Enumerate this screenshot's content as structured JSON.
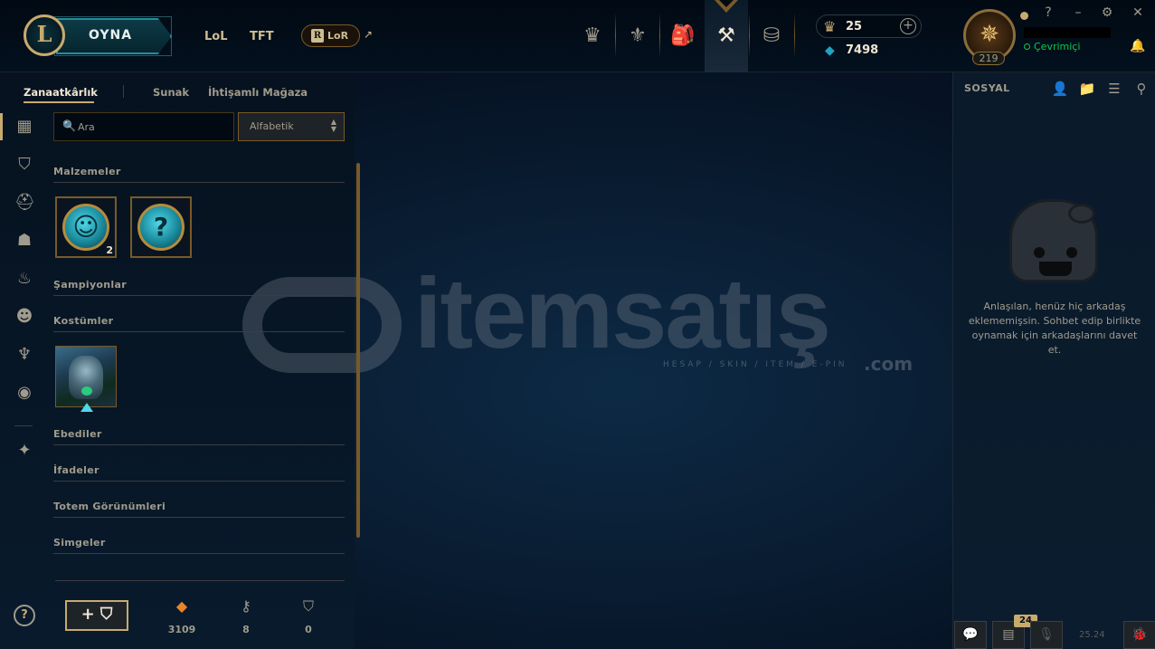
{
  "header": {
    "logo": "L",
    "play_label": "OYNA",
    "links": [
      "LoL",
      "TFT"
    ],
    "lor_label": "LoR",
    "lor_logo": "R",
    "external_icon": "external-link-icon",
    "nav_icons": [
      "worlds-trophy-icon",
      "clash-icon",
      "store-bag-icon",
      "crafting-hammer-icon",
      "coins-stack-icon"
    ],
    "active_nav": "crafting-hammer-icon",
    "riot_points": "25",
    "add_rp": "+",
    "blue_essence": "7498",
    "summoner_level": "219",
    "status": "Çevrimiçi",
    "window_controls": [
      "?",
      "–",
      "⚙",
      "✕"
    ]
  },
  "subtabs": [
    "Zanaatkârlık",
    "Sunak",
    "İhtişamlı Mağaza"
  ],
  "active_subtab": "Zanaatkârlık",
  "rail": {
    "icons": [
      "grid-icon",
      "chest-icon",
      "champion-helmet-icon",
      "skin-mask-icon",
      "ward-flame-icon",
      "emote-face-icon",
      "totem-icon",
      "summoner-icon-icon",
      "eternals-icon"
    ],
    "help": "?"
  },
  "search": {
    "placeholder": "Ara"
  },
  "sort": {
    "selected": "Alfabetik"
  },
  "categories": {
    "materials": "Malzemeler",
    "champions": "Şampiyonlar",
    "skins": "Kostümler",
    "eternals": "Ebediler",
    "emotes": "İfadeler",
    "ward_skins": "Totem Görünümleri",
    "icons": "Simgeler"
  },
  "materials": [
    {
      "name": "emote-orb-icon",
      "glyph": "☺",
      "count": "2"
    },
    {
      "name": "mystery-orb-icon",
      "glyph": "?",
      "count": ""
    }
  ],
  "footer": {
    "add_chest": "+ ⛉",
    "resources": [
      {
        "icon": "orange-essence-icon",
        "glyph": "◆",
        "color": "#e8842a",
        "value": "3109"
      },
      {
        "icon": "key-icon",
        "glyph": "⚷",
        "color": "#a09b8c",
        "value": "8"
      },
      {
        "icon": "chest-icon",
        "glyph": "⛉",
        "color": "#a09b8c",
        "value": "0"
      }
    ]
  },
  "watermark": {
    "brand": "itemsatış",
    "tagline": "HESAP / SKIN / ITEM / E-PIN",
    "suffix": ".com"
  },
  "social": {
    "title": "SOSYAL",
    "empty_text": "Anlaşılan, henüz hiç arkadaş eklememişsin. Sohbet edip birlikte oynamak için arkadaşlarını davet et.",
    "notifications": "24",
    "version": "25.24"
  },
  "colors": {
    "gold": "#c8aa6e",
    "teal": "#1e8fa0",
    "online": "#0acb4c"
  }
}
